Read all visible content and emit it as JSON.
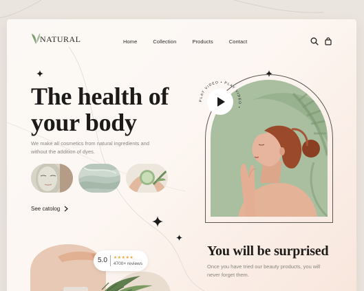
{
  "brand": {
    "logo_text": "NATURAL"
  },
  "nav": {
    "items": [
      "Home",
      "Collection",
      "Products",
      "Contact"
    ]
  },
  "header_icons": [
    "search-icon",
    "shopping-bag-icon"
  ],
  "hero": {
    "title_line1": "The health of",
    "title_line2": "your body",
    "subtitle": "We make all cosmetics from natural ingredients and without the addition of dyes.",
    "thumbnails": [
      "clay-mask-face",
      "green-cream-texture",
      "hands-with-cucumber"
    ],
    "catalog_link": "See catolog"
  },
  "play_badge": {
    "ring_text": "PLAY VIDEO • PLAY VIDEO •"
  },
  "rating": {
    "score": "5.0",
    "stars": "★★★★★",
    "reviews": "4700+ reviews"
  },
  "section": {
    "title": "You will be surprised",
    "text": "Once you have tried our beauty products, you will never forget them."
  },
  "colors": {
    "accent_green": "#a9bfa0",
    "skin": "#e7b59d",
    "hair": "#9a4a2a",
    "text_dark": "#1c1b19",
    "text_muted": "#8a8580"
  }
}
